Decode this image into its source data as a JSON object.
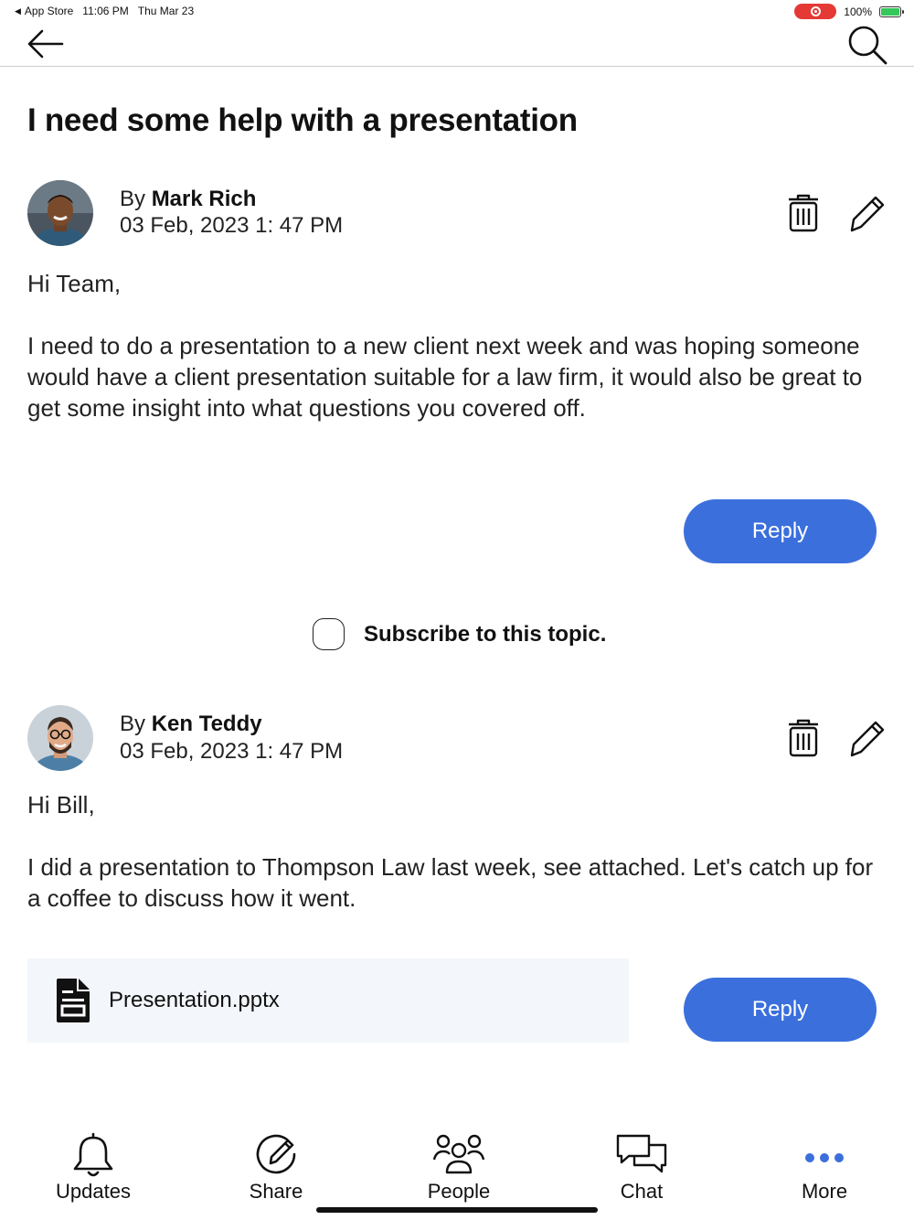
{
  "status_bar": {
    "back_app": "App Store",
    "time": "11:06 PM",
    "date": "Thu Mar 23",
    "battery": "100%"
  },
  "nav": {
    "back_icon": "arrow-left-icon",
    "search_icon": "search-icon"
  },
  "page_title": "I need some help with a presentation",
  "posts": [
    {
      "by_prefix": "By",
      "author": "Mark Rich",
      "date": "03 Feb, 2023 1: 47 PM",
      "greeting": "Hi Team,",
      "body": "I need to do a presentation to a new client next week and was hoping someone would have a client presentation suitable for a law firm, it would also be great to get some insight into what questions you covered off.",
      "reply_label": "Reply"
    },
    {
      "by_prefix": "By",
      "author": "Ken Teddy",
      "date": "03 Feb, 2023 1: 47 PM",
      "greeting": "Hi Bill,",
      "body": "I did a presentation to Thompson Law last week, see attached. Let's catch up for a coffee to discuss how it went.",
      "attachment": "Presentation.pptx",
      "reply_label": "Reply"
    }
  ],
  "subscribe": {
    "label": "Subscribe to this topic.",
    "checked": false
  },
  "tabs": [
    {
      "label": "Updates",
      "icon": "bell-icon"
    },
    {
      "label": "Share",
      "icon": "pencil-circle-icon"
    },
    {
      "label": "People",
      "icon": "people-icon"
    },
    {
      "label": "Chat",
      "icon": "chat-bubbles-icon"
    },
    {
      "label": "More",
      "icon": "more-dots-icon"
    }
  ],
  "colors": {
    "accent": "#3b6fdc",
    "attachment_bg": "#f3f6fa",
    "record": "#e53935",
    "battery": "#34c759"
  }
}
